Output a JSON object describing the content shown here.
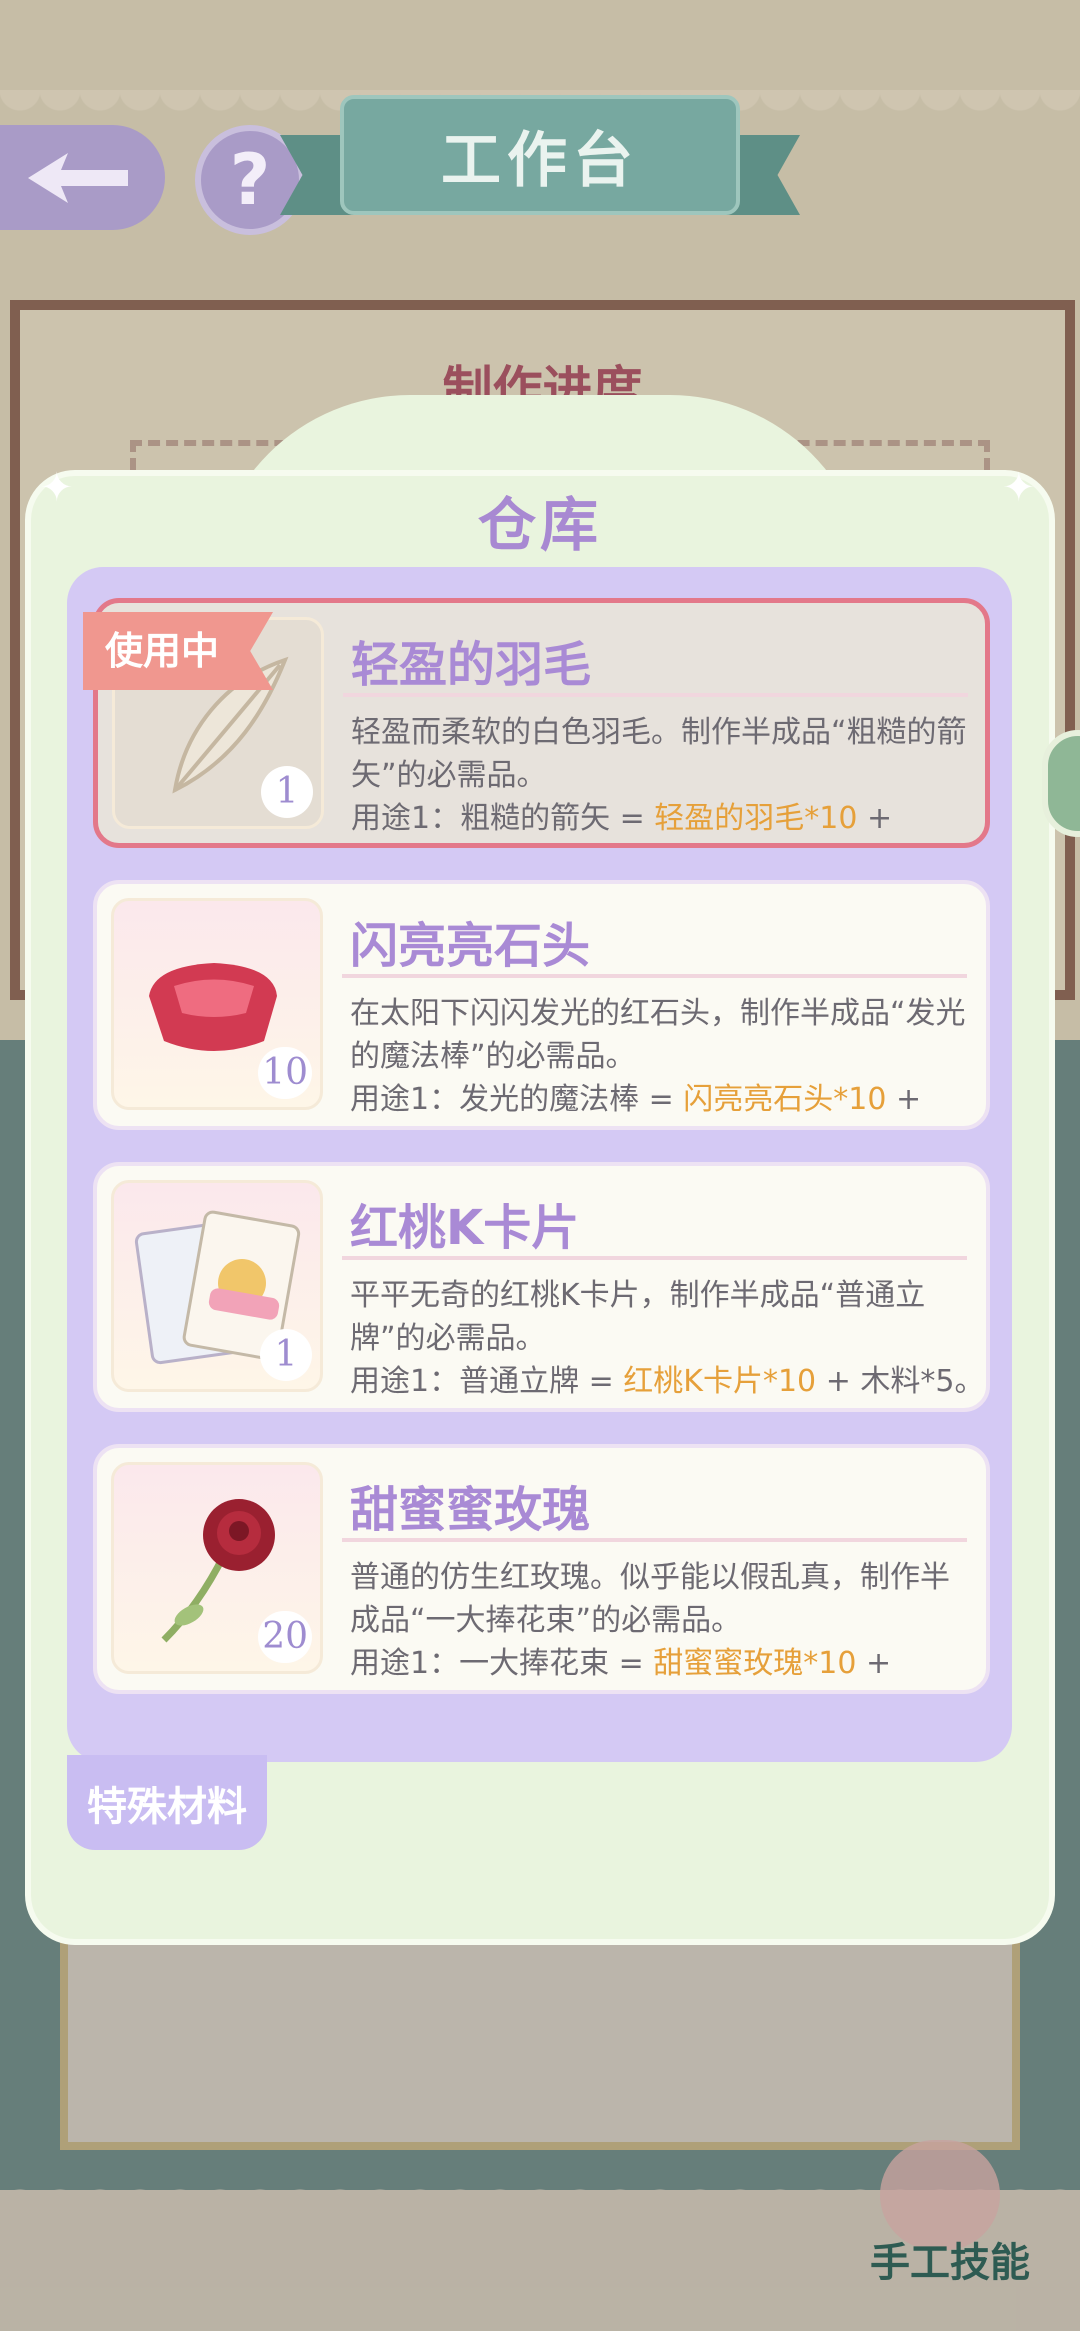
{
  "header": {
    "title": "工作台"
  },
  "background_panel": {
    "title": "制作进度"
  },
  "warehouse": {
    "title": "仓库",
    "in_use_tag": "使用中",
    "items": [
      {
        "name": "轻盈的羽毛",
        "count": "1",
        "desc": "轻盈而柔软的白色羽毛。制作半成品“粗糙的箭矢”的必需品。",
        "use_prefix": "用途1：粗糙的箭矢 = ",
        "use_highlight": "轻盈的羽毛*10",
        "use_suffix": " +",
        "icon": "feather-icon",
        "selected": true
      },
      {
        "name": "闪亮亮石头",
        "count": "10",
        "desc": "在太阳下闪闪发光的红石头，制作半成品“发光的魔法棒”的必需品。",
        "use_prefix": "用途1：发光的魔法棒 = ",
        "use_highlight": "闪亮亮石头*10",
        "use_suffix": " +",
        "icon": "red-gem-icon"
      },
      {
        "name": "红桃K卡片",
        "count": "1",
        "desc": "平平无奇的红桃K卡片，制作半成品“普通立牌”的必需品。",
        "use_prefix": "用途1：普通立牌 = ",
        "use_highlight": "红桃K卡片*10",
        "use_suffix": " + 木料*5。",
        "icon": "playing-card-icon"
      },
      {
        "name": "甜蜜蜜玫瑰",
        "count": "20",
        "desc": "普通的仿生红玫瑰。似乎能以假乱真，制作半成品“一大捧花束”的必需品。",
        "use_prefix": "用途1：一大捧花束 = ",
        "use_highlight": "甜蜜蜜玫瑰*10",
        "use_suffix": " +",
        "icon": "rose-icon"
      }
    ],
    "tab_special": "特殊材料"
  },
  "footer": {
    "skill_label": "手工技能"
  },
  "colors": {
    "accent": "#a98ad5",
    "highlight": "#e6a03a",
    "selected_border": "#e3788a"
  }
}
